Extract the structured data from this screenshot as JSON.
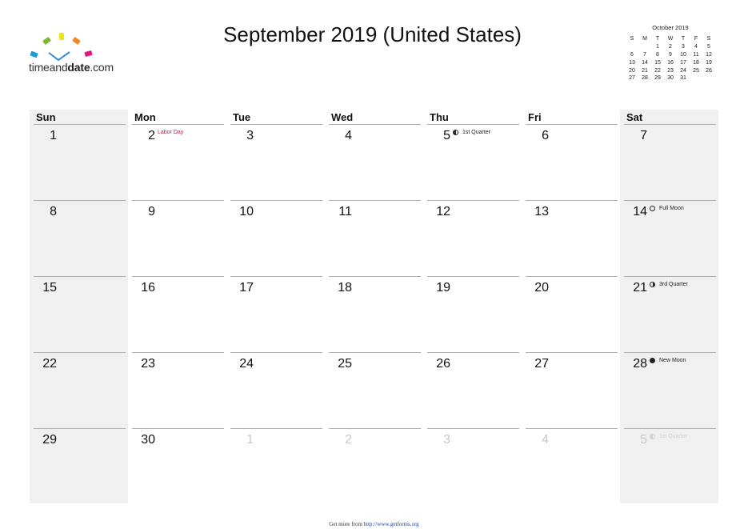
{
  "logo": {
    "text_light": "timeand",
    "text_bold": "date",
    "text_suffix": ".com",
    "colors": [
      "#1e9bd7",
      "#7cb82f",
      "#f2e21a",
      "#f08a24",
      "#e2187b"
    ],
    "check_color": "#2f8fd8"
  },
  "title": "September 2019 (United States)",
  "mini_calendar": {
    "title": "October 2019",
    "weekday_headers": [
      "S",
      "M",
      "T",
      "W",
      "T",
      "F",
      "S"
    ],
    "weeks": [
      [
        "",
        "",
        "1",
        "2",
        "3",
        "4",
        "5"
      ],
      [
        "6",
        "7",
        "8",
        "9",
        "10",
        "11",
        "12"
      ],
      [
        "13",
        "14",
        "15",
        "16",
        "17",
        "18",
        "19"
      ],
      [
        "20",
        "21",
        "22",
        "23",
        "24",
        "25",
        "26"
      ],
      [
        "27",
        "28",
        "29",
        "30",
        "31",
        "",
        ""
      ]
    ]
  },
  "calendar": {
    "weekdays": [
      "Sun",
      "Mon",
      "Tue",
      "Wed",
      "Thu",
      "Fri",
      "Sat"
    ],
    "weekend_bg": "#f0f0f0",
    "holiday_color": "#c2185b",
    "weeks": [
      [
        {
          "day": "1"
        },
        {
          "day": "2",
          "event": "Labor Day",
          "type": "holiday"
        },
        {
          "day": "3"
        },
        {
          "day": "4"
        },
        {
          "day": "5",
          "event": "1st Quarter",
          "type": "moon",
          "moon": "first"
        },
        {
          "day": "6"
        },
        {
          "day": "7"
        }
      ],
      [
        {
          "day": "8"
        },
        {
          "day": "9"
        },
        {
          "day": "10"
        },
        {
          "day": "11"
        },
        {
          "day": "12"
        },
        {
          "day": "13"
        },
        {
          "day": "14",
          "event": "Full Moon",
          "type": "moon",
          "moon": "full"
        }
      ],
      [
        {
          "day": "15"
        },
        {
          "day": "16"
        },
        {
          "day": "17"
        },
        {
          "day": "18"
        },
        {
          "day": "19"
        },
        {
          "day": "20"
        },
        {
          "day": "21",
          "event": "3rd Quarter",
          "type": "moon",
          "moon": "third"
        }
      ],
      [
        {
          "day": "22"
        },
        {
          "day": "23"
        },
        {
          "day": "24"
        },
        {
          "day": "25"
        },
        {
          "day": "26"
        },
        {
          "day": "27"
        },
        {
          "day": "28",
          "event": "New Moon",
          "type": "moon",
          "moon": "new"
        }
      ],
      [
        {
          "day": "29"
        },
        {
          "day": "30"
        },
        {
          "day": "1",
          "out": true
        },
        {
          "day": "2",
          "out": true
        },
        {
          "day": "3",
          "out": true
        },
        {
          "day": "4",
          "out": true
        },
        {
          "day": "5",
          "out": true,
          "event": "1st Quarter",
          "type": "moon",
          "moon": "first"
        }
      ]
    ]
  },
  "footer": {
    "prefix": "Get more from ",
    "link": "http://www.getforms.org"
  }
}
